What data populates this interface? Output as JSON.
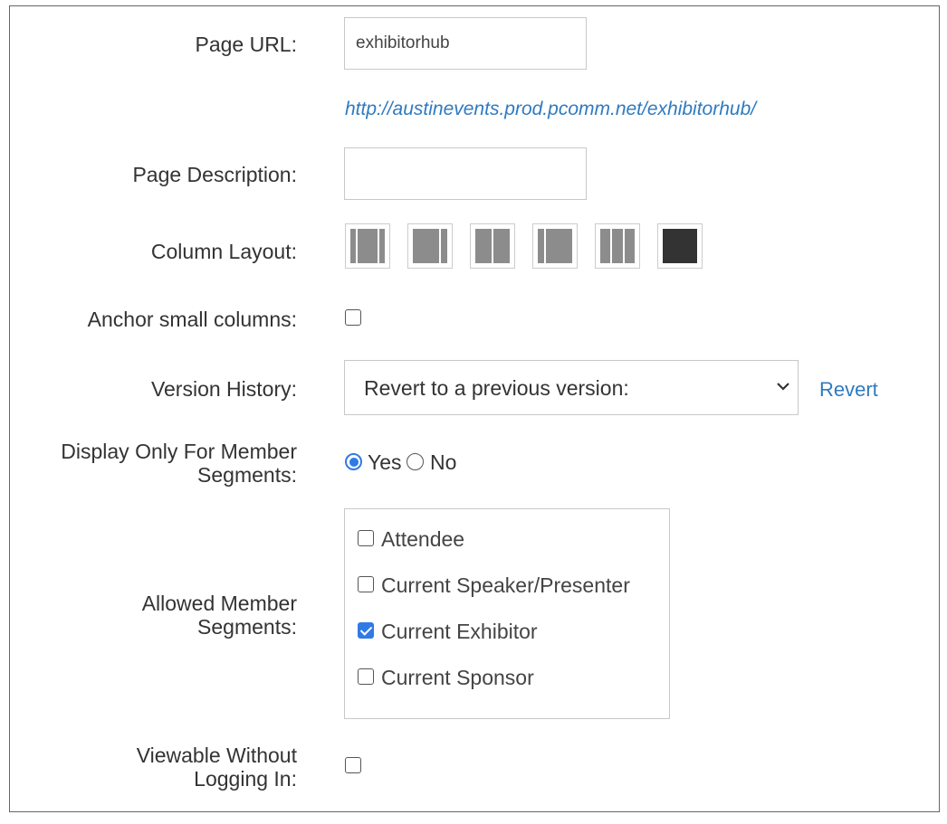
{
  "form": {
    "page_url": {
      "label": "Page URL:",
      "value": "exhibitorhub",
      "full_url": "http://austinevents.prod.pcomm.net/exhibitorhub/"
    },
    "page_description": {
      "label": "Page Description:",
      "value": ""
    },
    "column_layout": {
      "label": "Column Layout:",
      "options": [
        {
          "icon": "three-column-narrow-sides-icon"
        },
        {
          "icon": "two-column-wide-left-icon"
        },
        {
          "icon": "two-column-equal-icon"
        },
        {
          "icon": "two-column-wide-right-icon"
        },
        {
          "icon": "three-column-equal-icon"
        },
        {
          "icon": "single-column-icon",
          "selected": true
        }
      ]
    },
    "anchor_small_columns": {
      "label": "Anchor small columns:",
      "checked": false
    },
    "version_history": {
      "label": "Version History:",
      "selected": "Revert to a previous version:",
      "revert_label": "Revert"
    },
    "display_only_for_segments": {
      "label_line1": "Display Only For Member",
      "label_line2": "Segments:",
      "options": [
        {
          "label": "Yes",
          "checked": true
        },
        {
          "label": "No",
          "checked": false
        }
      ]
    },
    "allowed_segments": {
      "label_line1": "Allowed Member",
      "label_line2": "Segments:",
      "items": [
        {
          "label": "Attendee",
          "checked": false
        },
        {
          "label": "Current Speaker/Presenter",
          "checked": false
        },
        {
          "label": "Current Exhibitor",
          "checked": true
        },
        {
          "label": "Current Sponsor",
          "checked": false
        }
      ]
    },
    "viewable_without_login": {
      "label_line1": "Viewable Without",
      "label_line2": "Logging In:",
      "checked": false
    }
  },
  "colors": {
    "accent": "#2f7ae5",
    "link": "#2f7ac0",
    "layout_icon_gray": "#8c8c8c",
    "layout_icon_selected": "#333333"
  }
}
